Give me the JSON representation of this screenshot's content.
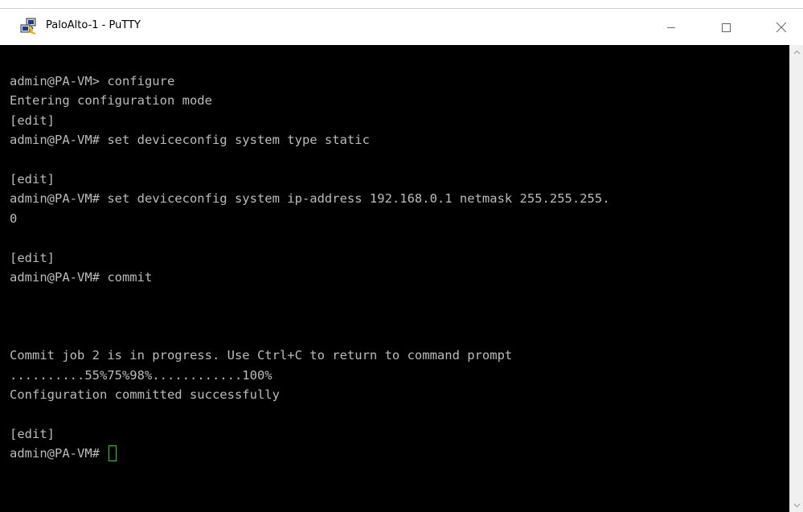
{
  "window": {
    "title": "PaloAlto-1 - PuTTY",
    "icon": "putty-icon",
    "controls": {
      "minimize": "minimize-icon",
      "maximize": "maximize-icon",
      "close": "close-icon"
    }
  },
  "terminal": {
    "lines": [
      "admin@PA-VM> configure",
      "Entering configuration mode",
      "[edit]",
      "admin@PA-VM# set deviceconfig system type static",
      "",
      "[edit]",
      "admin@PA-VM# set deviceconfig system ip-address 192.168.0.1 netmask 255.255.255.",
      "0",
      "",
      "[edit]",
      "admin@PA-VM# commit",
      "",
      "",
      "",
      "Commit job 2 is in progress. Use Ctrl+C to return to command prompt",
      "..........55%75%98%............100%",
      "Configuration committed successfully",
      "",
      "[edit]",
      "admin@PA-VM# "
    ],
    "colors": {
      "background": "#000000",
      "foreground": "#bbbbbb",
      "cursor": "#00e000"
    }
  }
}
